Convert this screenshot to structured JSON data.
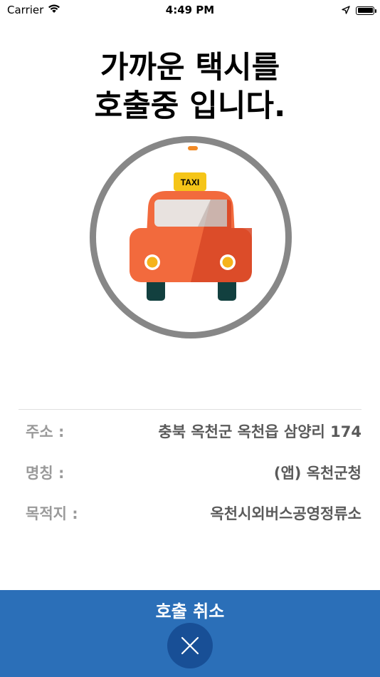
{
  "status_bar": {
    "carrier": "Carrier",
    "time": "4:49 PM"
  },
  "title": {
    "line1": "가까운  택시를",
    "line2": "호출중 입니다."
  },
  "taxi_sign": "TAXI",
  "info": [
    {
      "label": "주소 :",
      "value": "충북 옥천군 옥천읍 삼양리 174"
    },
    {
      "label": "명칭 :",
      "value": "(앱) 옥천군청"
    },
    {
      "label": "목적지 :",
      "value": "옥천시외버스공영정류소"
    }
  ],
  "bottom": {
    "cancel_label": "호출 취소"
  },
  "colors": {
    "accent": "#2b6fb8",
    "cancel_button": "#184f96",
    "ring": "#878787",
    "taxi_body": "#f26a3d",
    "taxi_sign": "#f5c518"
  },
  "icons": [
    "wifi-icon",
    "location-arrow-icon",
    "battery-icon",
    "taxi-icon",
    "close-icon"
  ]
}
